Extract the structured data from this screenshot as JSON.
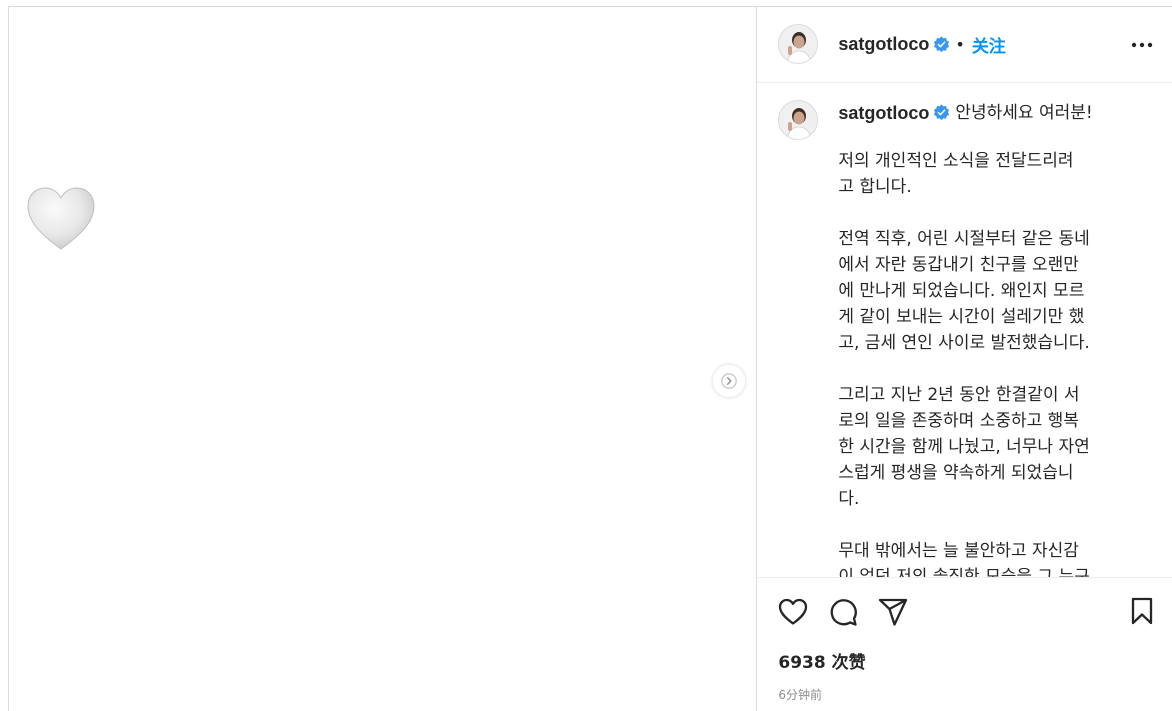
{
  "post": {
    "media": {
      "emoji_icon": "white-heart-icon",
      "next_icon": "chevron-right-icon"
    },
    "header": {
      "username": "satgotloco",
      "verified_icon": "verified-badge-icon",
      "dot": "•",
      "follow_label": "关注",
      "more_icon": "more-options-icon"
    },
    "caption": {
      "username": "satgotloco",
      "greeting": "안녕하세요 여러분!",
      "paragraphs": [
        "저의 개인적인 소식을 전달드리려\n고 합니다.",
        "전역 직후, 어린 시절부터 같은 동네\n에서 자란 동갑내기 친구를 오랜만\n에 만나게 되었습니다. 왜인지 모르\n게 같이 보내는 시간이 설레기만 했\n고, 금세 연인 사이로 발전했습니다.",
        "그리고 지난 2년 동안 한결같이 서\n로의 일을 존중하며 소중하고 행복\n한 시간을 함께 나눴고, 너무나 자연\n스럽게 평생을 약속하게 되었습니\n다.",
        "무대 밖에서는 늘 불안하고 자신감\n이 없던 저의 솔직한 모습을 그 누구\n보다도 잘 이해해 주는 친구입니다.\n덕분에 이제는 저를 위한 선택을 두\n려워하지 않고 일상의 행복을 붙아"
      ]
    },
    "actions": {
      "like_icon": "heart-outline-icon",
      "comment_icon": "comment-icon",
      "share_icon": "paper-plane-icon",
      "save_icon": "bookmark-icon"
    },
    "likes_text": "6938 次赞",
    "time_text": "6分钟前",
    "colors": {
      "accent": "#0095f6",
      "verified": "#3897f0",
      "text": "#262626",
      "muted": "#8e8e8e",
      "border": "#dbdbdb"
    }
  }
}
